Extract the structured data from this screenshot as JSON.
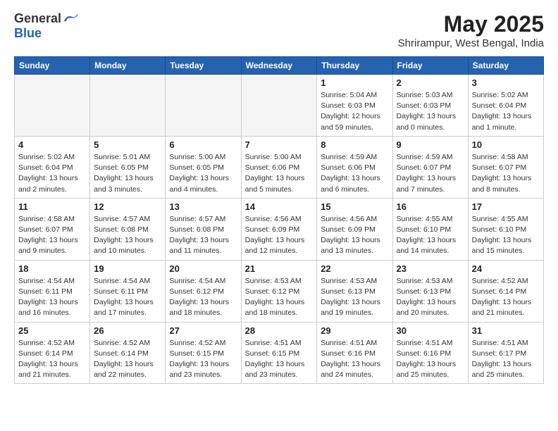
{
  "logo": {
    "general": "General",
    "blue": "Blue"
  },
  "header": {
    "month": "May 2025",
    "location": "Shrirampur, West Bengal, India"
  },
  "weekdays": [
    "Sunday",
    "Monday",
    "Tuesday",
    "Wednesday",
    "Thursday",
    "Friday",
    "Saturday"
  ],
  "weeks": [
    [
      {
        "day": "",
        "info": ""
      },
      {
        "day": "",
        "info": ""
      },
      {
        "day": "",
        "info": ""
      },
      {
        "day": "",
        "info": ""
      },
      {
        "day": "1",
        "info": "Sunrise: 5:04 AM\nSunset: 6:03 PM\nDaylight: 12 hours and 59 minutes."
      },
      {
        "day": "2",
        "info": "Sunrise: 5:03 AM\nSunset: 6:03 PM\nDaylight: 13 hours and 0 minutes."
      },
      {
        "day": "3",
        "info": "Sunrise: 5:02 AM\nSunset: 6:04 PM\nDaylight: 13 hours and 1 minute."
      }
    ],
    [
      {
        "day": "4",
        "info": "Sunrise: 5:02 AM\nSunset: 6:04 PM\nDaylight: 13 hours and 2 minutes."
      },
      {
        "day": "5",
        "info": "Sunrise: 5:01 AM\nSunset: 6:05 PM\nDaylight: 13 hours and 3 minutes."
      },
      {
        "day": "6",
        "info": "Sunrise: 5:00 AM\nSunset: 6:05 PM\nDaylight: 13 hours and 4 minutes."
      },
      {
        "day": "7",
        "info": "Sunrise: 5:00 AM\nSunset: 6:06 PM\nDaylight: 13 hours and 5 minutes."
      },
      {
        "day": "8",
        "info": "Sunrise: 4:59 AM\nSunset: 6:06 PM\nDaylight: 13 hours and 6 minutes."
      },
      {
        "day": "9",
        "info": "Sunrise: 4:59 AM\nSunset: 6:07 PM\nDaylight: 13 hours and 7 minutes."
      },
      {
        "day": "10",
        "info": "Sunrise: 4:58 AM\nSunset: 6:07 PM\nDaylight: 13 hours and 8 minutes."
      }
    ],
    [
      {
        "day": "11",
        "info": "Sunrise: 4:58 AM\nSunset: 6:07 PM\nDaylight: 13 hours and 9 minutes."
      },
      {
        "day": "12",
        "info": "Sunrise: 4:57 AM\nSunset: 6:08 PM\nDaylight: 13 hours and 10 minutes."
      },
      {
        "day": "13",
        "info": "Sunrise: 4:57 AM\nSunset: 6:08 PM\nDaylight: 13 hours and 11 minutes."
      },
      {
        "day": "14",
        "info": "Sunrise: 4:56 AM\nSunset: 6:09 PM\nDaylight: 13 hours and 12 minutes."
      },
      {
        "day": "15",
        "info": "Sunrise: 4:56 AM\nSunset: 6:09 PM\nDaylight: 13 hours and 13 minutes."
      },
      {
        "day": "16",
        "info": "Sunrise: 4:55 AM\nSunset: 6:10 PM\nDaylight: 13 hours and 14 minutes."
      },
      {
        "day": "17",
        "info": "Sunrise: 4:55 AM\nSunset: 6:10 PM\nDaylight: 13 hours and 15 minutes."
      }
    ],
    [
      {
        "day": "18",
        "info": "Sunrise: 4:54 AM\nSunset: 6:11 PM\nDaylight: 13 hours and 16 minutes."
      },
      {
        "day": "19",
        "info": "Sunrise: 4:54 AM\nSunset: 6:11 PM\nDaylight: 13 hours and 17 minutes."
      },
      {
        "day": "20",
        "info": "Sunrise: 4:54 AM\nSunset: 6:12 PM\nDaylight: 13 hours and 18 minutes."
      },
      {
        "day": "21",
        "info": "Sunrise: 4:53 AM\nSunset: 6:12 PM\nDaylight: 13 hours and 18 minutes."
      },
      {
        "day": "22",
        "info": "Sunrise: 4:53 AM\nSunset: 6:13 PM\nDaylight: 13 hours and 19 minutes."
      },
      {
        "day": "23",
        "info": "Sunrise: 4:53 AM\nSunset: 6:13 PM\nDaylight: 13 hours and 20 minutes."
      },
      {
        "day": "24",
        "info": "Sunrise: 4:52 AM\nSunset: 6:14 PM\nDaylight: 13 hours and 21 minutes."
      }
    ],
    [
      {
        "day": "25",
        "info": "Sunrise: 4:52 AM\nSunset: 6:14 PM\nDaylight: 13 hours and 21 minutes."
      },
      {
        "day": "26",
        "info": "Sunrise: 4:52 AM\nSunset: 6:14 PM\nDaylight: 13 hours and 22 minutes."
      },
      {
        "day": "27",
        "info": "Sunrise: 4:52 AM\nSunset: 6:15 PM\nDaylight: 13 hours and 23 minutes."
      },
      {
        "day": "28",
        "info": "Sunrise: 4:51 AM\nSunset: 6:15 PM\nDaylight: 13 hours and 23 minutes."
      },
      {
        "day": "29",
        "info": "Sunrise: 4:51 AM\nSunset: 6:16 PM\nDaylight: 13 hours and 24 minutes."
      },
      {
        "day": "30",
        "info": "Sunrise: 4:51 AM\nSunset: 6:16 PM\nDaylight: 13 hours and 25 minutes."
      },
      {
        "day": "31",
        "info": "Sunrise: 4:51 AM\nSunset: 6:17 PM\nDaylight: 13 hours and 25 minutes."
      }
    ]
  ]
}
